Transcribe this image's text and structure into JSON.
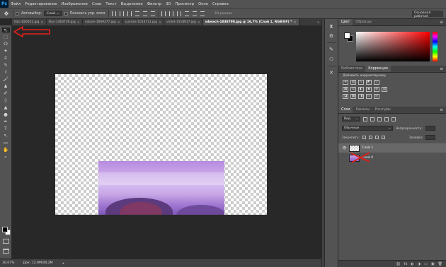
{
  "app": {
    "logo": "Ps"
  },
  "menubar": {
    "items": [
      "Файл",
      "Редактирование",
      "Изображение",
      "Слои",
      "Текст",
      "Выделение",
      "Фильтр",
      "3D",
      "Просмотр",
      "Окно",
      "Справка"
    ]
  },
  "options": {
    "tool_icon": "move-tool-icon",
    "autoselect_label": "Автовыбор:",
    "autoselect_value": "Слой",
    "transform_label": "Показать упр. элем.",
    "mode_3d_label": "3D-режим:",
    "workspace": "Основная рабочая"
  },
  "tabs": [
    {
      "label": "lilac-820031.jpg",
      "active": false
    },
    {
      "label": "lilac-1463739.jpg",
      "active": false
    },
    {
      "label": "nature-1669277.jpg",
      "active": false
    },
    {
      "label": "sunrise-1014711.jpg",
      "active": false
    },
    {
      "label": "violet-1518917.jpg",
      "active": false
    },
    {
      "label": "wbeach-1838798.jpg @ 16,7% (Слой 1, RGB/8#) *",
      "active": true
    }
  ],
  "tabs_overflow": "»",
  "toolbar": {
    "tools": [
      "↖",
      "⬚",
      "ⵔ",
      "✦",
      "⌗",
      "✎",
      "⚕",
      "🖌",
      "♟",
      "✐",
      "◊",
      "▲",
      "●",
      "✒",
      "T",
      "↖",
      "▭",
      "✋",
      "⌕"
    ]
  },
  "status": {
    "zoom": "16,67%",
    "info": "Док: 12,9M/44,2M",
    "arrow": "▸"
  },
  "color_panel": {
    "tabs": [
      "Цвет",
      "Образцы"
    ],
    "foreground": "#ffffff",
    "background": "#000000"
  },
  "adjustments_panel": {
    "tabs": [
      "Библиотеки",
      "Коррекция"
    ],
    "title": "Добавить корректировку"
  },
  "layers_panel": {
    "tabs": [
      "Слои",
      "Каналы",
      "Контуры"
    ],
    "filter_label": "Вид",
    "blend_mode": "Обычные",
    "opacity_label": "Непрозрачность:",
    "lock_label": "Закрепить:",
    "fill_label": "Заливка:",
    "layers": [
      {
        "name": "Слой 1",
        "visible": true,
        "selected": true,
        "thumb": "checker"
      },
      {
        "name": "Слой 0",
        "visible": false,
        "selected": false,
        "thumb": "photo"
      }
    ],
    "bottom_icons": [
      "⛓",
      "fx",
      "◐",
      "◑",
      "▭",
      "▣",
      "🗑"
    ]
  },
  "annotation_colors": {
    "arrow": "#e0201a",
    "x_mark": "#e0201a"
  }
}
